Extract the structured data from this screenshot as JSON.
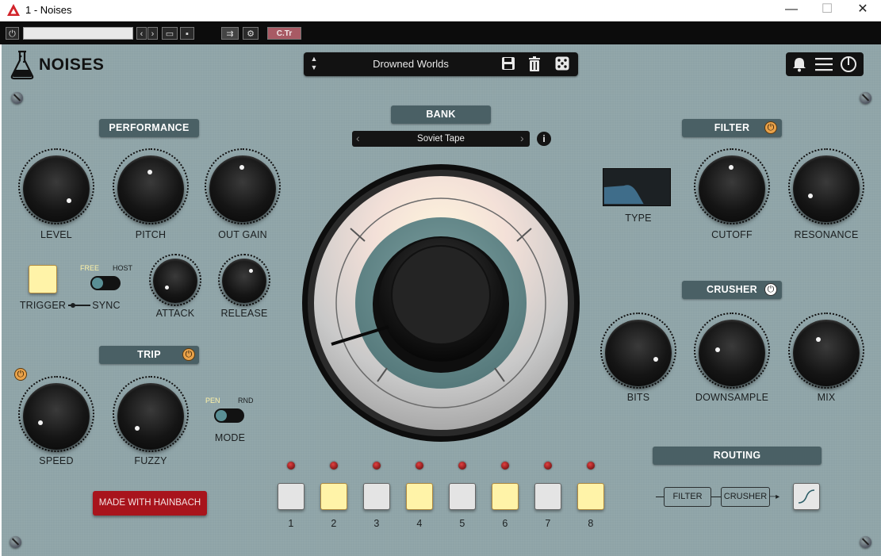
{
  "window": {
    "title": "1 - Noises",
    "minimize": "—",
    "maximize": "☐",
    "close": "✕"
  },
  "hostbar": {
    "preset_field": "",
    "ctr_label": "C.Tr"
  },
  "plugin": {
    "name": "NOISES",
    "preset_name": "Drowned Worlds",
    "bank": {
      "header": "BANK",
      "name": "Soviet Tape",
      "info": "i"
    },
    "performance": {
      "header": "PERFORMANCE",
      "level": "LEVEL",
      "pitch": "PITCH",
      "out_gain": "OUT GAIN",
      "trigger": "TRIGGER",
      "sync": "SYNC",
      "free": "FREE",
      "host": "HOST",
      "attack": "ATTACK",
      "release": "RELEASE"
    },
    "trip": {
      "header": "TRIP",
      "speed": "SPEED",
      "fuzzy": "FUZZY",
      "pen": "PEN",
      "rnd": "RND",
      "mode": "MODE"
    },
    "made_with": "MADE WITH HAINBACH",
    "filter": {
      "header": "FILTER",
      "type": "TYPE",
      "cutoff": "CUTOFF",
      "resonance": "RESONANCE"
    },
    "crusher": {
      "header": "CRUSHER",
      "bits": "BITS",
      "downsample": "DOWNSAMPLE",
      "mix": "MIX"
    },
    "routing": {
      "header": "ROUTING",
      "first": "FILTER",
      "second": "CRUSHER"
    },
    "steps": [
      {
        "label": "1",
        "on": false
      },
      {
        "label": "2",
        "on": true
      },
      {
        "label": "3",
        "on": false
      },
      {
        "label": "4",
        "on": true
      },
      {
        "label": "5",
        "on": false
      },
      {
        "label": "6",
        "on": true
      },
      {
        "label": "7",
        "on": false
      },
      {
        "label": "8",
        "on": true
      }
    ],
    "colors": {
      "accent_orange": "#e9a24a",
      "step_on": "#fff3a8",
      "step_off": "#e4e4e4",
      "panel": "#8ea3a7",
      "header_pill": "#4a6065",
      "made_with_bg": "#a8141c"
    }
  }
}
